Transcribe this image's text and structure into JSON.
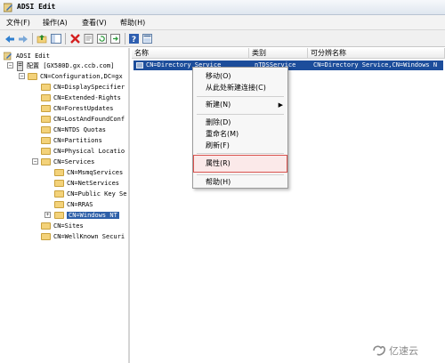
{
  "window": {
    "title": "ADSI Edit"
  },
  "menubar": [
    {
      "label": "文件(F)"
    },
    {
      "label": "操作(A)"
    },
    {
      "label": "查看(V)"
    },
    {
      "label": "帮助(H)"
    }
  ],
  "toolbar": {
    "icons": [
      "back-icon",
      "forward-icon",
      "up-icon",
      "show-tree-icon",
      "delete-icon",
      "properties-icon",
      "refresh-icon",
      "export-icon",
      "help-icon",
      "view-icon"
    ]
  },
  "tree": {
    "root": "ADSI Edit",
    "connection": "配置 [GX580D.gx.ccb.com]",
    "config": "CN=Configuration,DC=gx",
    "items": [
      "CN=DisplaySpecifier",
      "CN=Extended-Rights",
      "CN=ForestUpdates",
      "CN=LostAndFoundConf",
      "CN=NTDS Quotas",
      "CN=Partitions",
      "CN=Physical Locatio"
    ],
    "services": "CN=Services",
    "service_items": [
      "CN=MsmqServices",
      "CN=NetServices",
      "CN=Public Key Se",
      "CN=RRAS"
    ],
    "windows_nt": "CN=Windows NT",
    "sites": "CN=Sites",
    "wellknown": "CN=WellKnown Securi"
  },
  "list": {
    "headers": [
      "名称",
      "类别",
      "可分辨名称"
    ],
    "row": {
      "name": "CN=Directory Service",
      "class": "nTDSService",
      "dn": "CN=Directory Service,CN=Windows N"
    }
  },
  "context_menu": {
    "move": "移动(O)",
    "new_connection": "从此处新建连接(C)",
    "new": "新建(N)",
    "delete": "删除(D)",
    "rename": "重命名(M)",
    "refresh": "刷新(F)",
    "properties": "属性(R)",
    "help": "帮助(H)"
  },
  "watermark": {
    "text": "亿速云"
  },
  "colors": {
    "selection": "#1c4d9b",
    "highlight_box": "#d9534f"
  }
}
